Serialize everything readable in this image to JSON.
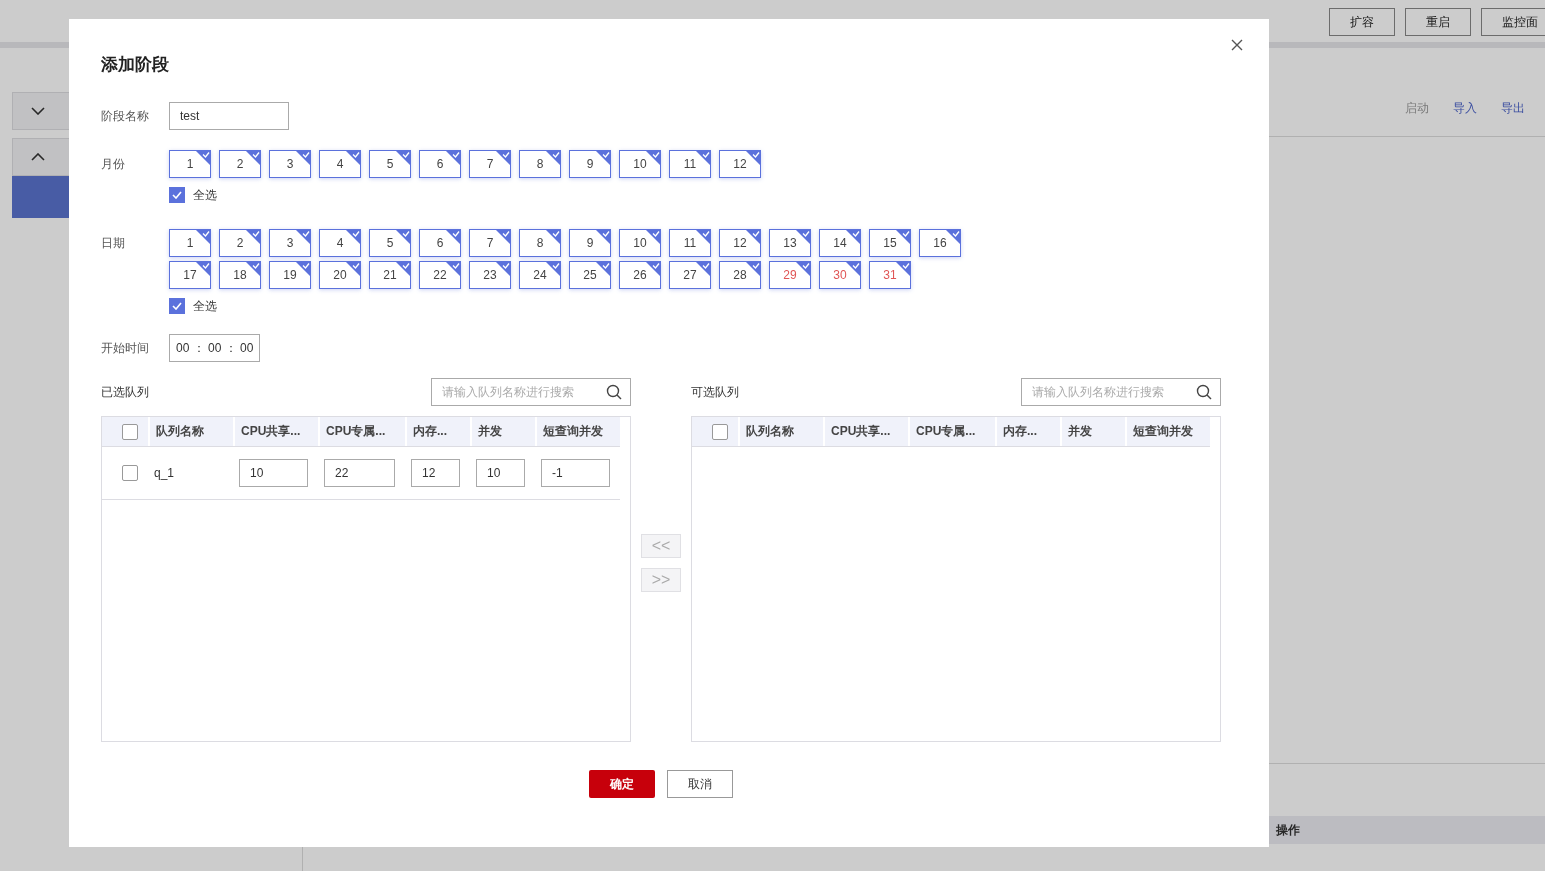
{
  "background": {
    "header_buttons": [
      "扩容",
      "重启",
      "监控面"
    ],
    "panels": [
      {
        "expanded": false
      },
      {
        "expanded": true
      }
    ],
    "actions": [
      {
        "label": "启动",
        "disabled": true
      },
      {
        "label": "导入",
        "disabled": false
      },
      {
        "label": "导出",
        "disabled": false
      }
    ],
    "table_header": "操作"
  },
  "dialog": {
    "title": "添加阶段",
    "name_field": {
      "label": "阶段名称",
      "value": "test"
    },
    "months": {
      "label": "月份",
      "items": [
        {
          "label": "1",
          "selected": true
        },
        {
          "label": "2",
          "selected": true
        },
        {
          "label": "3",
          "selected": true
        },
        {
          "label": "4",
          "selected": true
        },
        {
          "label": "5",
          "selected": true
        },
        {
          "label": "6",
          "selected": true
        },
        {
          "label": "7",
          "selected": true
        },
        {
          "label": "8",
          "selected": true
        },
        {
          "label": "9",
          "selected": true
        },
        {
          "label": "10",
          "selected": true
        },
        {
          "label": "11",
          "selected": true
        },
        {
          "label": "12",
          "selected": true
        }
      ],
      "select_all": {
        "label": "全选",
        "checked": true
      }
    },
    "dates": {
      "label": "日期",
      "items": [
        {
          "label": "1",
          "selected": true,
          "warning": false
        },
        {
          "label": "2",
          "selected": true,
          "warning": false
        },
        {
          "label": "3",
          "selected": true,
          "warning": false
        },
        {
          "label": "4",
          "selected": true,
          "warning": false
        },
        {
          "label": "5",
          "selected": true,
          "warning": false
        },
        {
          "label": "6",
          "selected": true,
          "warning": false
        },
        {
          "label": "7",
          "selected": true,
          "warning": false
        },
        {
          "label": "8",
          "selected": true,
          "warning": false
        },
        {
          "label": "9",
          "selected": true,
          "warning": false
        },
        {
          "label": "10",
          "selected": true,
          "warning": false
        },
        {
          "label": "11",
          "selected": true,
          "warning": false
        },
        {
          "label": "12",
          "selected": true,
          "warning": false
        },
        {
          "label": "13",
          "selected": true,
          "warning": false
        },
        {
          "label": "14",
          "selected": true,
          "warning": false
        },
        {
          "label": "15",
          "selected": true,
          "warning": false
        },
        {
          "label": "16",
          "selected": true,
          "warning": false
        },
        {
          "label": "17",
          "selected": true,
          "warning": false
        },
        {
          "label": "18",
          "selected": true,
          "warning": false
        },
        {
          "label": "19",
          "selected": true,
          "warning": false
        },
        {
          "label": "20",
          "selected": true,
          "warning": false
        },
        {
          "label": "21",
          "selected": true,
          "warning": false
        },
        {
          "label": "22",
          "selected": true,
          "warning": false
        },
        {
          "label": "23",
          "selected": true,
          "warning": false
        },
        {
          "label": "24",
          "selected": true,
          "warning": false
        },
        {
          "label": "25",
          "selected": true,
          "warning": false
        },
        {
          "label": "26",
          "selected": true,
          "warning": false
        },
        {
          "label": "27",
          "selected": true,
          "warning": false
        },
        {
          "label": "28",
          "selected": true,
          "warning": false
        },
        {
          "label": "29",
          "selected": true,
          "warning": true
        },
        {
          "label": "30",
          "selected": true,
          "warning": true
        },
        {
          "label": "31",
          "selected": true,
          "warning": true
        }
      ],
      "select_all": {
        "label": "全选",
        "checked": true
      }
    },
    "start_time": {
      "label": "开始时间",
      "value": "00 ： 00 ： 00"
    },
    "selected_queues": {
      "title": "已选队列",
      "search_placeholder": "请输入队列名称进行搜索",
      "header_checked": false,
      "columns": [
        "队列名称",
        "CPU共享...",
        "CPU专属...",
        "内存...",
        "并发",
        "短查询并发"
      ],
      "rows": [
        {
          "checked": false,
          "name": "q_1",
          "values": [
            "10",
            "22",
            "12",
            "10",
            "-1"
          ]
        }
      ]
    },
    "move_buttons": [
      "<<",
      ">>"
    ],
    "available_queues": {
      "title": "可选队列",
      "search_placeholder": "请输入队列名称进行搜索",
      "header_checked": false,
      "columns": [
        "队列名称",
        "CPU共享...",
        "CPU专属...",
        "内存...",
        "并发",
        "短查询并发"
      ]
    },
    "buttons": [
      {
        "label": "确定",
        "kind": "primary"
      },
      {
        "label": "取消",
        "kind": "secondary"
      }
    ]
  }
}
